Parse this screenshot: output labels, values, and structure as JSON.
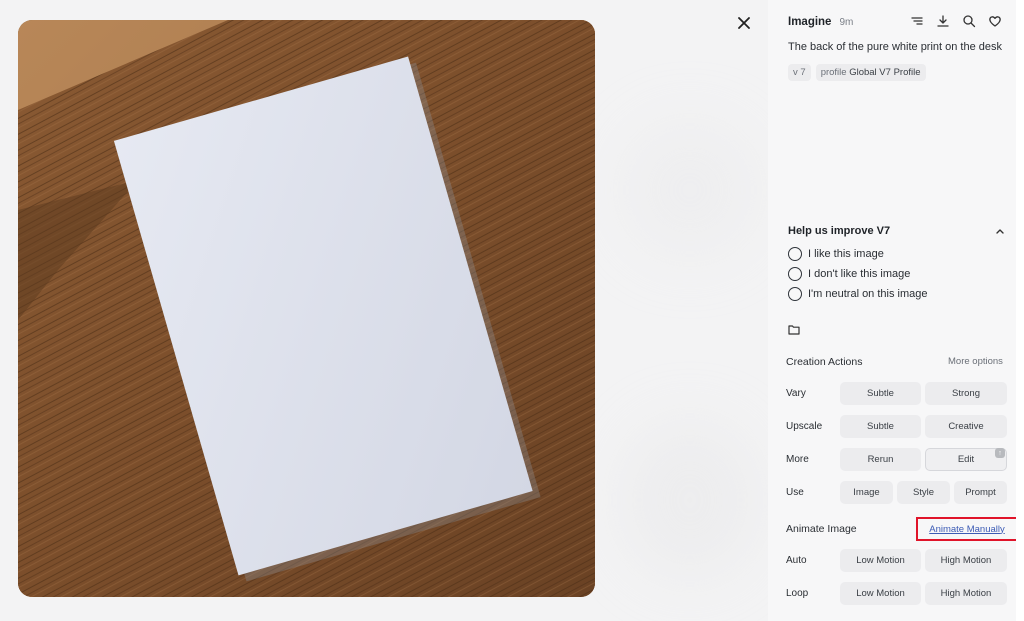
{
  "header": {
    "title": "Imagine",
    "age": "9m",
    "icons": [
      "filter-lines-icon",
      "download-icon",
      "search-icon",
      "heart-icon"
    ]
  },
  "prompt": "The back of the pure white print on the desk",
  "tags": {
    "version": "v 7",
    "profile_prefix": "profile",
    "profile_name": "Global V7 Profile"
  },
  "feedback": {
    "title": "Help us improve V7",
    "options": [
      "I like this image",
      "I don't like this image",
      "I'm neutral on this image"
    ]
  },
  "creation": {
    "title": "Creation Actions",
    "more_options": "More options",
    "vary": {
      "label": "Vary",
      "subtle": "Subtle",
      "strong": "Strong"
    },
    "upscale": {
      "label": "Upscale",
      "subtle": "Subtle",
      "creative": "Creative"
    },
    "more": {
      "label": "More",
      "rerun": "Rerun",
      "edit": "Edit"
    },
    "use": {
      "label": "Use",
      "image": "Image",
      "style": "Style",
      "prompt": "Prompt"
    }
  },
  "animate": {
    "title": "Animate Image",
    "manual": "Animate Manually",
    "auto": {
      "label": "Auto",
      "low": "Low Motion",
      "high": "High Motion"
    },
    "loop": {
      "label": "Loop",
      "low": "Low Motion",
      "high": "High Motion"
    }
  },
  "colors": {
    "highlight": "#e0142a",
    "link": "#3c5bb5",
    "panel_bg": "#f7f7f8",
    "button_bg": "#ececee"
  }
}
